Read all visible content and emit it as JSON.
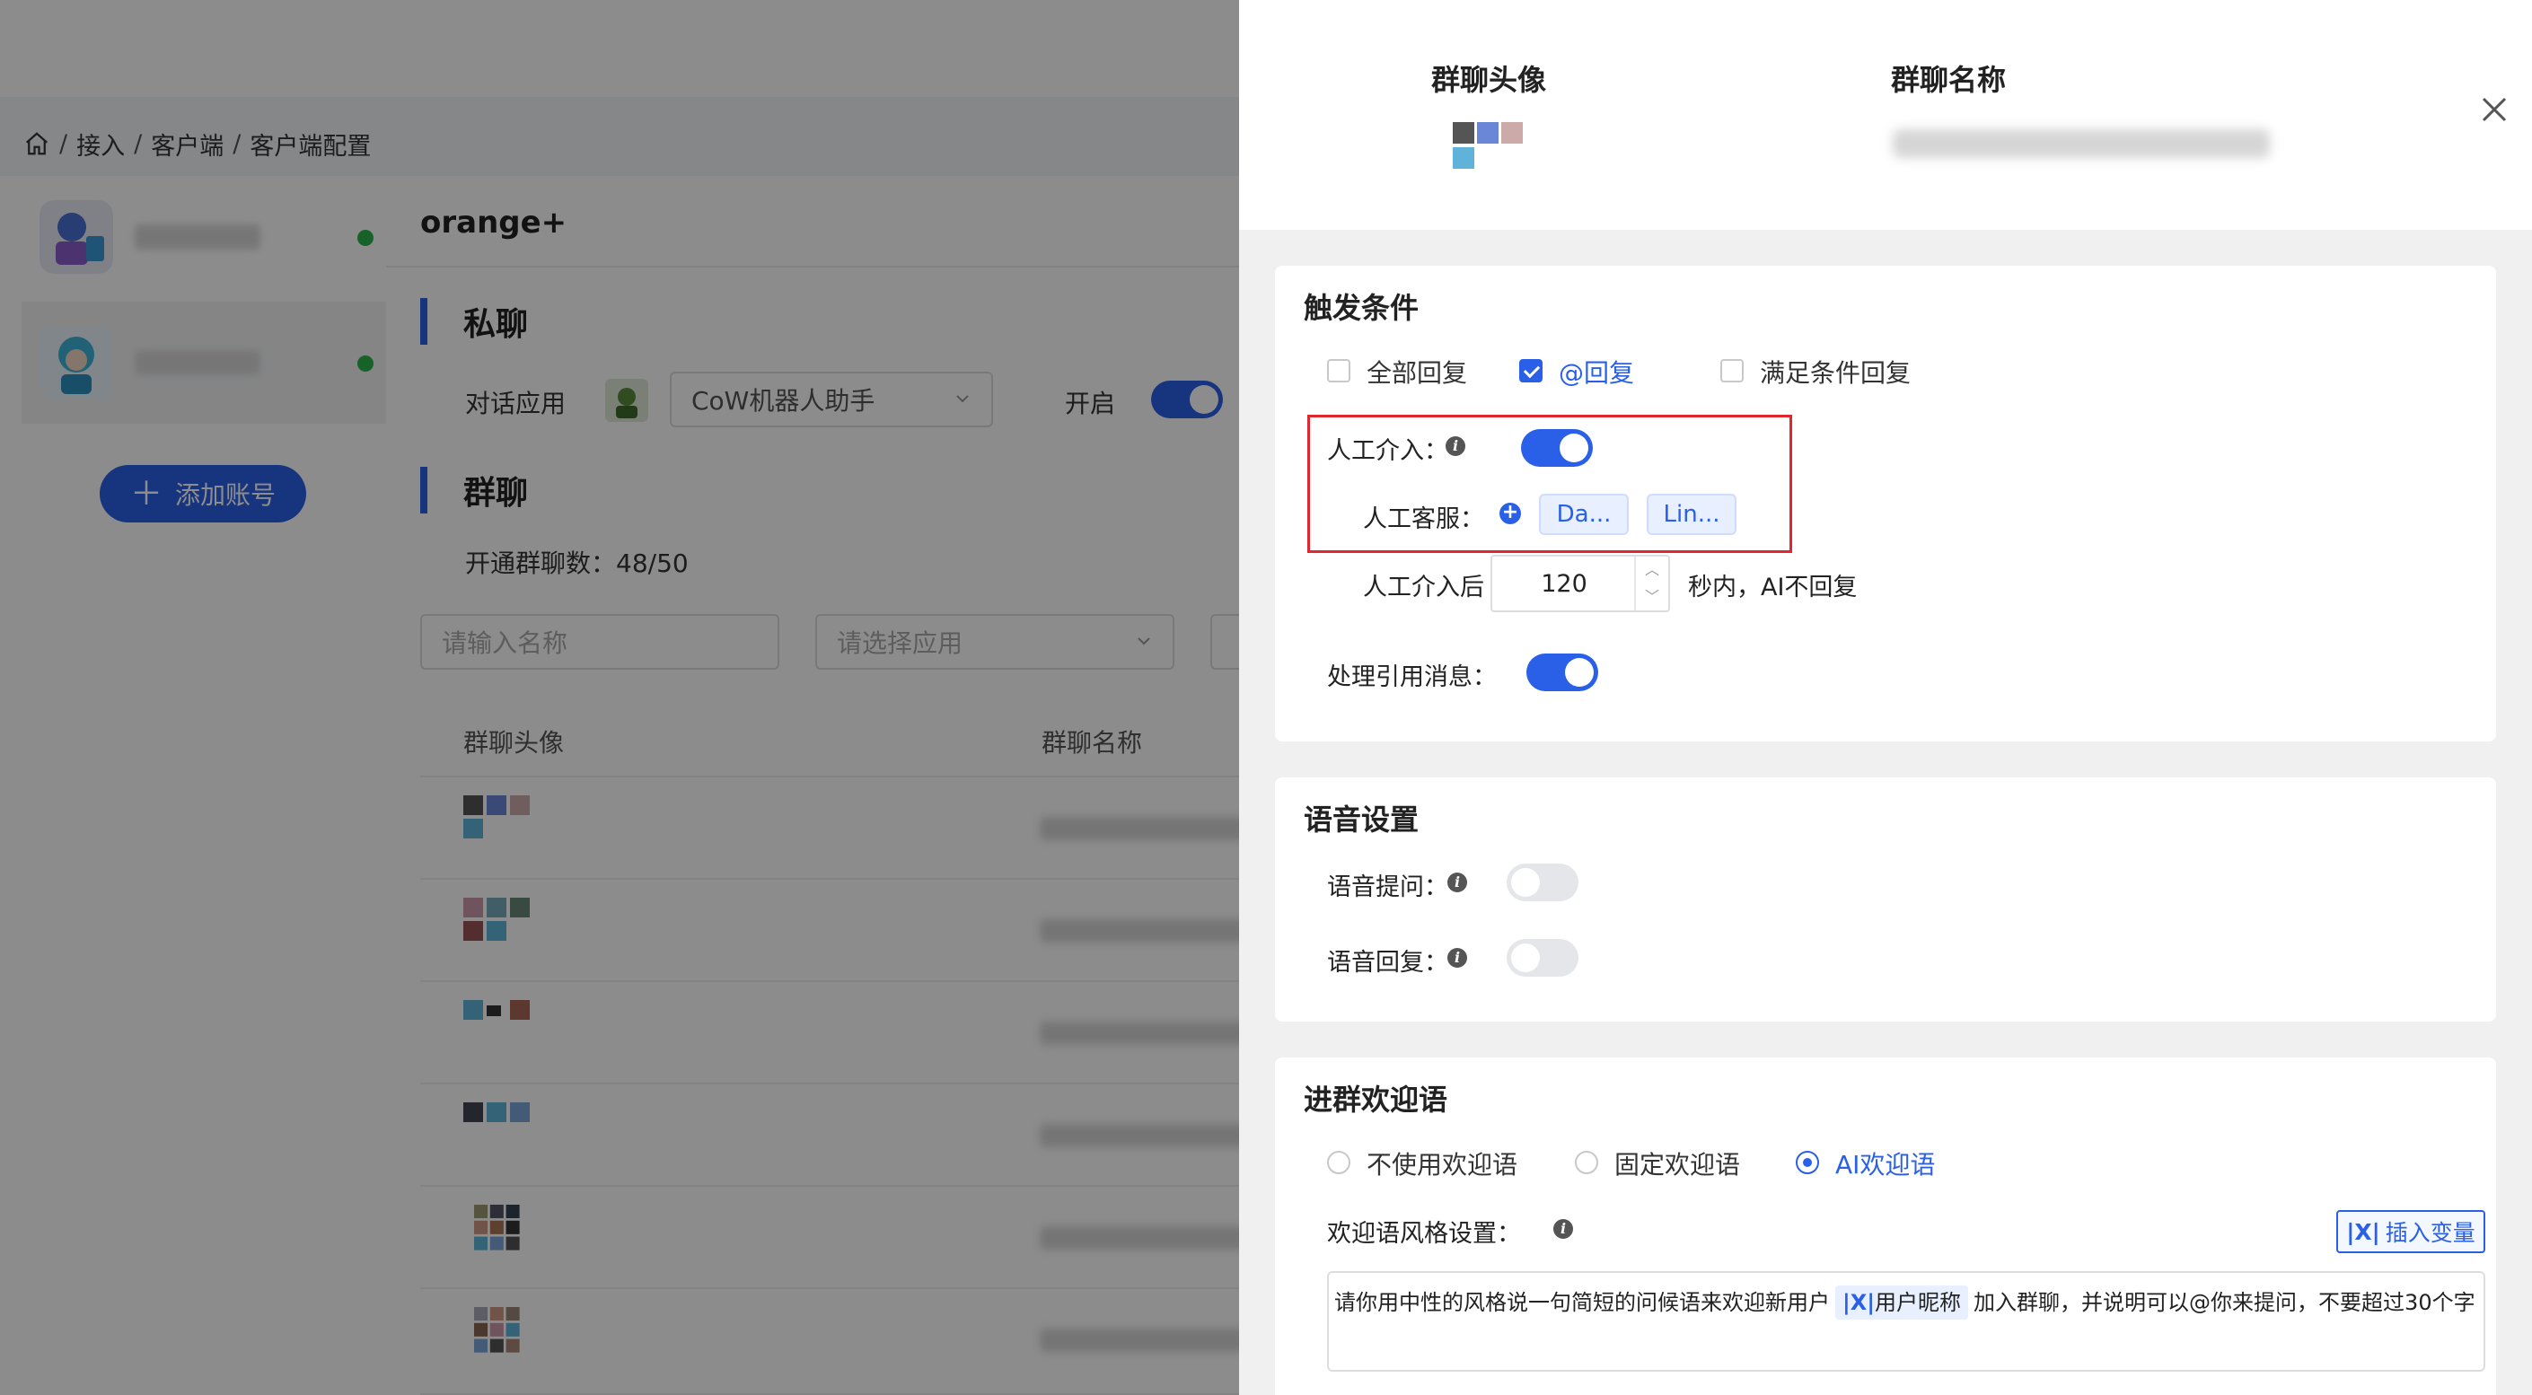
{
  "breadcrumb": {
    "items": [
      "接入",
      "客户端",
      "客户端配置"
    ]
  },
  "accounts": {
    "add_label": "添加账号"
  },
  "main": {
    "app_name": "orange+",
    "private_section": "私聊",
    "dialog_app_label": "对话应用",
    "dialog_app_value": "CoW机器人助手",
    "enable_label": "开启",
    "group_section": "群聊",
    "group_count_label": "开通群聊数：48/50",
    "name_placeholder": "请输入名称",
    "app_placeholder": "请选择应用",
    "columns": {
      "avatar": "群聊头像",
      "name": "群聊名称"
    }
  },
  "drawer": {
    "avatar_header": "群聊头像",
    "name_header": "群聊名称",
    "trigger": {
      "title": "触发条件",
      "options": [
        {
          "label": "全部回复",
          "checked": false
        },
        {
          "label": "@回复",
          "checked": true
        },
        {
          "label": "满足条件回复",
          "checked": false
        }
      ],
      "manual_label": "人工介入：",
      "manual_enabled": true,
      "agent_label": "人工客服：",
      "agents": [
        "Da...",
        "Lin..."
      ],
      "after_label": "人工介入后",
      "after_value": "120",
      "after_suffix": "秒内，AI不回复",
      "quote_label": "处理引用消息：",
      "quote_enabled": true
    },
    "voice": {
      "title": "语音设置",
      "ask_label": "语音提问：",
      "ask_enabled": false,
      "reply_label": "语音回复：",
      "reply_enabled": false
    },
    "welcome": {
      "title": "进群欢迎语",
      "options": [
        {
          "label": "不使用欢迎语",
          "selected": false
        },
        {
          "label": "固定欢迎语",
          "selected": false
        },
        {
          "label": "AI欢迎语",
          "selected": true
        }
      ],
      "style_label": "欢迎语风格设置：",
      "insert_label": "插入变量",
      "prompt_before": "请你用中性的风格说一句简短的问候语来欢迎新用户",
      "variable": "用户昵称",
      "prompt_after": "加入群聊，并说明可以@你来提问，不要超过30个字"
    }
  },
  "colors": {
    "accent": "#2a60e8",
    "online": "#2bb24c",
    "highlight_box": "#e0262e"
  }
}
